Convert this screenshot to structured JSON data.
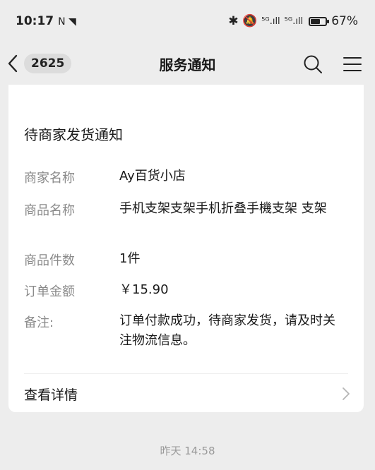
{
  "status_bar": {
    "time": "10:17",
    "time_icons": "N ◥",
    "right_icons": "✱ 🔕",
    "signal_1": "⁵ᴳ.ıll",
    "signal_2": "⁵ᴳ.ıll",
    "battery": "67%"
  },
  "nav": {
    "back_icon": "chevron-left-icon",
    "unread_count": "2625",
    "title": "服务通知",
    "search_icon": "search-icon",
    "menu_icon": "menu-icon"
  },
  "card": {
    "title": "待商家发货通知",
    "fields": [
      {
        "label": "商家名称",
        "value": "Ay百货小店"
      },
      {
        "label": "商品名称",
        "value": "手机支架支架手机折叠手機支架 支架"
      },
      {
        "label": "商品件数",
        "value": "1件"
      },
      {
        "label": "订单金额",
        "value": "￥15.90"
      },
      {
        "label": "备注:",
        "value": "订单付款成功，待商家发货，请及时关注物流信息。"
      }
    ],
    "details_label": "查看详情"
  },
  "timestamp": "昨天 14:58",
  "colors": {
    "background": "#ededed",
    "card": "#ffffff",
    "label": "#8a8a8a",
    "text": "#1a1a1a"
  }
}
